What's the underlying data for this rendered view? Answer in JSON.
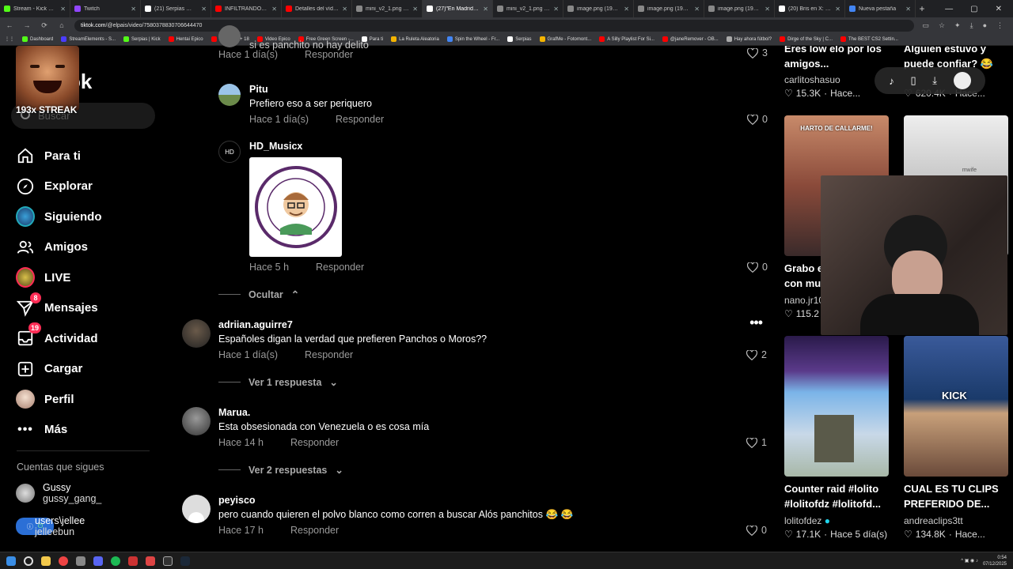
{
  "browser": {
    "tabs": [
      {
        "title": "Stream - Kick Dashb",
        "color": "#53fc18",
        "active": false
      },
      {
        "title": "Twitch",
        "color": "#9146ff",
        "active": false
      },
      {
        "title": "(21) Serpias 🔺 en",
        "color": "#ffffff",
        "active": false
      },
      {
        "title": "INFILTRÁNDOME E",
        "color": "#ff0000",
        "active": false
      },
      {
        "title": "Detalles del vídeo -",
        "color": "#ff0000",
        "active": false
      },
      {
        "title": "mini_v2_1.png (136",
        "color": "#888888",
        "active": false
      },
      {
        "title": "(27)\"En Madrid no",
        "color": "#ffffff",
        "active": true
      },
      {
        "title": "mini_v2_1.png (136",
        "color": "#888888",
        "active": false
      },
      {
        "title": "image.png (1920×",
        "color": "#888888",
        "active": false
      },
      {
        "title": "image.png (1920×",
        "color": "#888888",
        "active": false
      },
      {
        "title": "image.png (1920×",
        "color": "#888888",
        "active": false
      },
      {
        "title": "(20) Bris en X: \"Apr",
        "color": "#ffffff",
        "active": false
      },
      {
        "title": "Nueva pestaña",
        "color": "#4285f4",
        "active": false
      }
    ],
    "url_host": "tiktok.com",
    "url_path": "/@elpais/video/7580378830706644470",
    "bookmarks": [
      {
        "label": "Dashboard",
        "color": "#53fc18"
      },
      {
        "label": "StreamElements - S...",
        "color": "#4b3dff"
      },
      {
        "label": "Serpias | Kick",
        "color": "#53fc18"
      },
      {
        "label": "Hentai Epico",
        "color": "#ff0000"
      },
      {
        "label": "Femboys + 18",
        "color": "#ff0000"
      },
      {
        "label": "Video Epico",
        "color": "#ff0000"
      },
      {
        "label": "Free Green Screen -...",
        "color": "#ff0000"
      },
      {
        "label": "Para ti",
        "color": "#ffffff"
      },
      {
        "label": "La Ruleta Aleatoria",
        "color": "#f4b400"
      },
      {
        "label": "Spin the Wheel - Fr...",
        "color": "#4285f4"
      },
      {
        "label": "Serpias",
        "color": "#ffffff"
      },
      {
        "label": "GrafMe - Fotomont...",
        "color": "#f4b400"
      },
      {
        "label": "A Silly Playlist For Si...",
        "color": "#ff0000"
      },
      {
        "label": "@janeRemover - OB...",
        "color": "#ff0000"
      },
      {
        "label": "Hay ahora fútbol?",
        "color": "#aaaaaa"
      },
      {
        "label": "Dirge of the Sky | C...",
        "color": "#ff0000"
      },
      {
        "label": "The BEST CS2 Settin...",
        "color": "#ff0000"
      }
    ]
  },
  "sidebar": {
    "logo_text": "ok",
    "streak": "193x STREAK",
    "search_placeholder": "Buscar",
    "items": [
      {
        "label": "Para ti",
        "icon": "home-icon"
      },
      {
        "label": "Explorar",
        "icon": "compass-icon"
      },
      {
        "label": "Siguiendo",
        "icon": "following-avatar-icon"
      },
      {
        "label": "Amigos",
        "icon": "friends-icon"
      },
      {
        "label": "LIVE",
        "icon": "live-avatar-icon"
      },
      {
        "label": "Mensajes",
        "icon": "send-icon",
        "badge": "8"
      },
      {
        "label": "Actividad",
        "icon": "inbox-icon",
        "badge": "19"
      },
      {
        "label": "Cargar",
        "icon": "upload-icon"
      },
      {
        "label": "Perfil",
        "icon": "profile-avatar-icon"
      },
      {
        "label": "Más",
        "icon": "more-icon"
      }
    ],
    "following_title": "Cuentas que sigues",
    "accounts": [
      {
        "name": "Gussy",
        "handle": "gussy_gang_"
      },
      {
        "name": "users\\jellee",
        "handle": "jelleebun"
      }
    ]
  },
  "comments": {
    "top_partial": {
      "text": "si es panchito no hay delito",
      "time": "Hace 1 día(s)",
      "reply": "Responder",
      "likes": "3"
    },
    "replies": [
      {
        "name": "Pitu",
        "text": "Prefiero eso a ser periquero",
        "time": "Hace 1 día(s)",
        "reply": "Responder",
        "likes": "0"
      },
      {
        "name": "HD_Musicx",
        "sticker_text": "CERTIFICADO DE QUE VIVES EN MOHAREDEESPAÑA",
        "time": "Hace 5 h",
        "reply": "Responder",
        "likes": "0"
      }
    ],
    "hide_label": "Ocultar",
    "main": [
      {
        "name": "adriian.aguirre7",
        "text": "Españoles digan la verdad que prefieren Panchos o Moros??",
        "time": "Hace 1 día(s)",
        "reply": "Responder",
        "likes": "2",
        "toggle": "Ver 1 respuesta"
      },
      {
        "name": "Marua.",
        "text": "Esta obsesionada con Venezuela o es cosa mía",
        "time": "Hace 14 h",
        "reply": "Responder",
        "likes": "1",
        "toggle": "Ver 2 respuestas"
      },
      {
        "name": "peyisco",
        "text": "pero cuando quieren el polvo blanco como corren a buscar Alós panchitos 😂 😂",
        "time": "Hace 17 h",
        "reply": "Responder",
        "likes": "0"
      }
    ]
  },
  "videos": {
    "top_left": {
      "title_l1": "Eres low elo por los",
      "title_l2": "amigos...",
      "user": "carlitoshasuo",
      "likes": "15.3K",
      "time": "Hace..."
    },
    "top_right": {
      "title_l1": "Alguien estuvo y",
      "title_l2": "puede confiar? 😂",
      "user": "...",
      "likes": "620.4K",
      "time": "Hace..."
    },
    "mid_left": {
      "thumb_text": "HARTO DE CALLARME!",
      "title_l1": "Grabo e",
      "title_l2": "con mu",
      "user": "nano.jr10",
      "likes": "115.2"
    },
    "mid_right": {
      "thumb_text": "mwife"
    },
    "bottom_left": {
      "title_l1": "Counter raid #lolito",
      "title_l2": "#lolitofdz #lolitofd...",
      "user": "lolitofdez",
      "likes": "17.1K",
      "time": "Hace 5 día(s)"
    },
    "bottom_right": {
      "thumb_text": "KICK",
      "title_l1": "CUAL ES TU CLIPS",
      "title_l2": "PREFERIDO DE...",
      "user": "andreaclips3tt",
      "likes": "134.8K",
      "time": "Hace..."
    }
  },
  "taskbar": {
    "time": "0:54",
    "date": "07/12/2025"
  }
}
